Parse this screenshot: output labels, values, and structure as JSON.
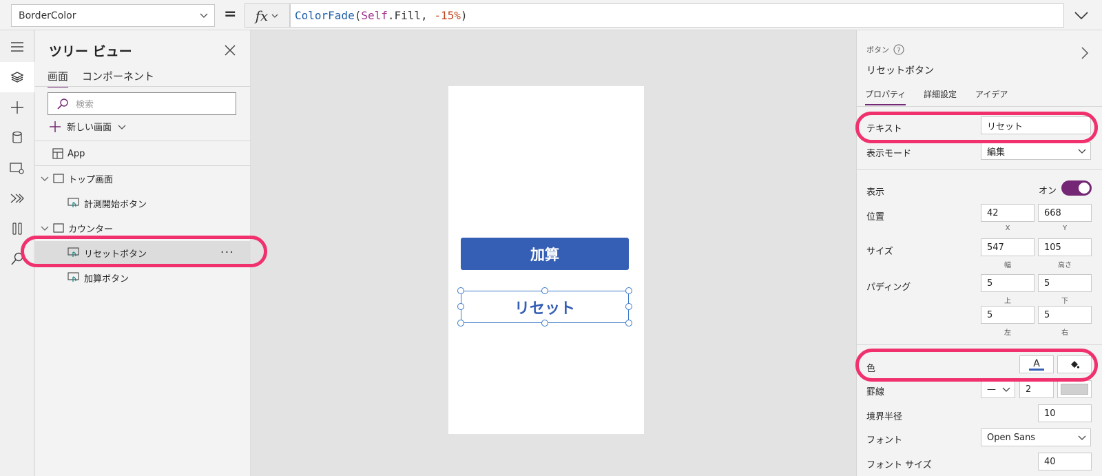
{
  "formula_bar": {
    "property": "BorderColor",
    "equals": "=",
    "fx": "fx",
    "formula_tokens": [
      {
        "text": "ColorFade",
        "kind": "fn"
      },
      {
        "text": "(",
        "kind": "pl"
      },
      {
        "text": "Self",
        "kind": "kw"
      },
      {
        "text": ".Fill, ",
        "kind": "pl"
      },
      {
        "text": "-15%",
        "kind": "num"
      },
      {
        "text": ")",
        "kind": "pl"
      }
    ]
  },
  "left_rail": {
    "icons": [
      "hamburger-icon",
      "layers-icon",
      "plus-icon",
      "database-icon",
      "media-icon",
      "automate-icon",
      "tools-icon",
      "search-icon"
    ]
  },
  "tree_view": {
    "title": "ツリー ビュー",
    "tabs": [
      "画面",
      "コンポーネント"
    ],
    "search_placeholder": "検索",
    "new_screen_label": "新しい画面",
    "items": [
      {
        "label": "App",
        "kind": "app",
        "level": 0
      },
      {
        "label": "トップ画面",
        "kind": "screen",
        "level": 0
      },
      {
        "label": "計測開始ボタン",
        "kind": "button",
        "level": 1
      },
      {
        "label": "カウンター",
        "kind": "screen",
        "level": 0
      },
      {
        "label": "リセットボタン",
        "kind": "button",
        "level": 1,
        "selected": true
      },
      {
        "label": "加算ボタン",
        "kind": "button",
        "level": 1
      }
    ],
    "more_label": "···"
  },
  "canvas": {
    "add_button_label": "加算",
    "reset_button_label": "リセット"
  },
  "properties": {
    "control_type": "ボタン",
    "control_name": "リセットボタン",
    "tabs": [
      "プロパティ",
      "詳細設定",
      "アイデア"
    ],
    "text_label": "テキスト",
    "text_value": "リセット",
    "display_mode_label": "表示モード",
    "display_mode_value": "編集",
    "visible_label": "表示",
    "visible_value": "オン",
    "position_label": "位置",
    "position_x": "42",
    "position_y": "668",
    "x_label": "X",
    "y_label": "Y",
    "size_label": "サイズ",
    "size_width": "547",
    "size_height": "105",
    "width_label": "幅",
    "height_label": "高さ",
    "padding_label": "パディング",
    "padding_top": "5",
    "padding_bottom": "5",
    "padding_left": "5",
    "padding_right": "5",
    "top_label": "上",
    "bottom_label": "下",
    "left_label": "左",
    "right_label": "右",
    "color_label": "色",
    "color_text_glyph": "A",
    "border_label": "罫線",
    "border_style": "—",
    "border_thickness": "2",
    "border_radius_label": "境界半径",
    "border_radius_value": "10",
    "font_label": "フォント",
    "font_value": "Open Sans",
    "font_size_label": "フォント サイズ",
    "font_size_value": "40"
  },
  "colors": {
    "accent": "#742774",
    "button_fill": "#355fb5",
    "highlight": "#f0316e"
  }
}
